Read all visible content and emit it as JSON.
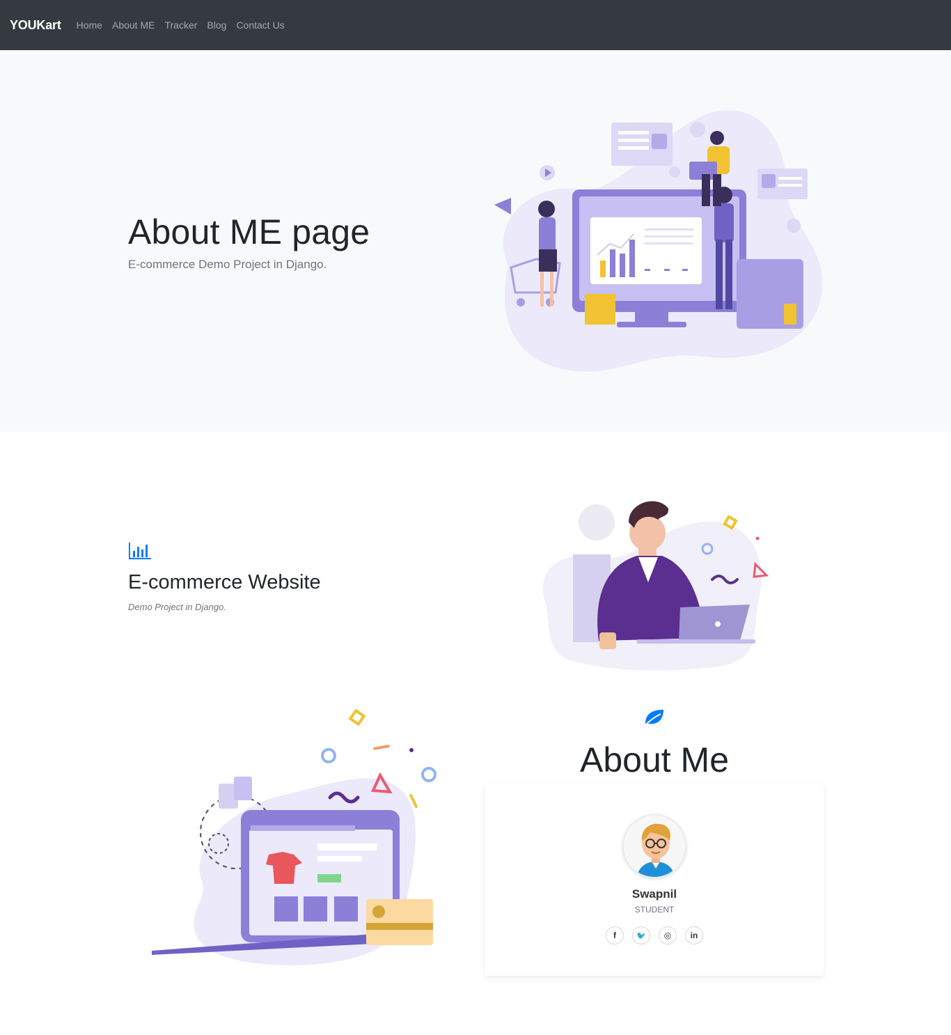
{
  "nav": {
    "brand": "YOUKart",
    "links": [
      "Home",
      "About ME",
      "Tracker",
      "Blog",
      "Contact Us"
    ]
  },
  "hero": {
    "title": "About ME page",
    "subtitle": "E-commerce Demo Project in Django."
  },
  "feature": {
    "icon": "bar-chart-icon",
    "title": "E-commerce Website",
    "subtitle": "Demo Project in Django."
  },
  "about": {
    "icon": "leaf-icon",
    "title": "About Me",
    "name": "Swapnil",
    "role": "STUDENT",
    "socials": [
      {
        "icon": "facebook-icon",
        "glyph": "f"
      },
      {
        "icon": "twitter-icon",
        "glyph": "🐦"
      },
      {
        "icon": "instagram-icon",
        "glyph": "◎"
      },
      {
        "icon": "linkedin-icon",
        "glyph": "in"
      }
    ]
  },
  "colors": {
    "navbar": "#343a40",
    "accent": "#007bff",
    "illustration": "#8f7fd6"
  }
}
